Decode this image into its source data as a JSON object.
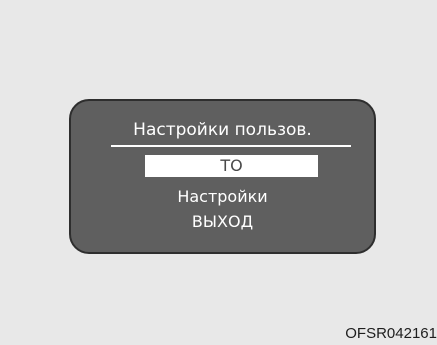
{
  "screen": {
    "title": "Настройки пользов.",
    "menu_items": [
      {
        "label": "ТО",
        "selected": true
      },
      {
        "label": "Настройки",
        "selected": false
      },
      {
        "label": "ВЫХОД",
        "selected": false
      }
    ]
  },
  "image_code": "OFSR042161",
  "colors": {
    "background": "#e8e8e8",
    "panel": "#5f5f5f",
    "panel_border": "#2e2e2e",
    "text": "#ffffff",
    "highlight": "#ffffff",
    "highlight_text": "#4a4a4a"
  }
}
